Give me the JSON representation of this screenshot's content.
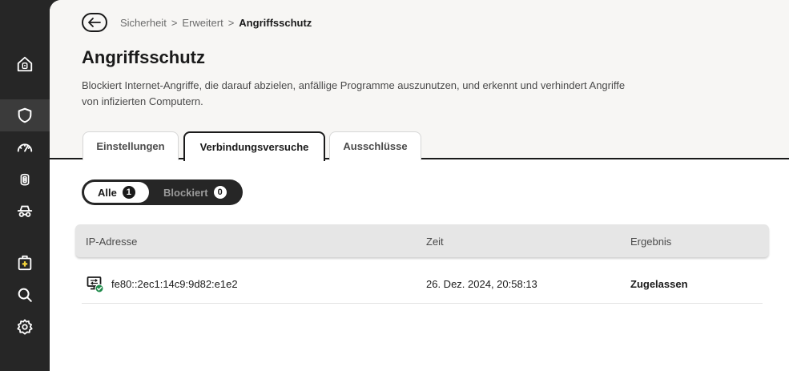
{
  "sidebar": {
    "items": [
      {
        "icon": "home-security-icon",
        "active": false
      },
      {
        "icon": "shield-icon",
        "active": true
      },
      {
        "icon": "speedometer-icon",
        "active": false
      },
      {
        "icon": "fingerprint-icon",
        "active": false
      },
      {
        "icon": "incognito-icon",
        "active": false
      },
      {
        "icon": "medical-kit-icon",
        "active": false
      },
      {
        "icon": "search-icon",
        "active": false
      },
      {
        "icon": "gear-icon",
        "active": false
      }
    ]
  },
  "breadcrumb": {
    "items": [
      "Sicherheit",
      "Erweitert"
    ],
    "current": "Angriffsschutz",
    "separator": ">"
  },
  "page": {
    "title": "Angriffsschutz",
    "description": "Blockiert Internet-Angriffe, die darauf abzielen, anfällige Programme auszunutzen, und erkennt und verhindert Angriffe von infizierten Computern."
  },
  "tabs": [
    {
      "label": "Einstellungen",
      "active": false
    },
    {
      "label": "Verbindungsversuche",
      "active": true
    },
    {
      "label": "Ausschlüsse",
      "active": false
    }
  ],
  "filter": {
    "all_label": "Alle",
    "all_count": "1",
    "blocked_label": "Blockiert",
    "blocked_count": "0",
    "selected": "Alle"
  },
  "table": {
    "headers": [
      "IP-Adresse",
      "Zeit",
      "Ergebnis"
    ],
    "rows": [
      {
        "ip": "fe80::2ec1:14c9:9d82:e1e2",
        "time": "26. Dez. 2024, 20:58:13",
        "result": "Zugelassen"
      }
    ]
  },
  "colors": {
    "sidebar_bg": "#262626",
    "header_bg": "#f7f6f4",
    "allowed_green": "#1e8a4a",
    "accent": "#1a1a1a"
  }
}
